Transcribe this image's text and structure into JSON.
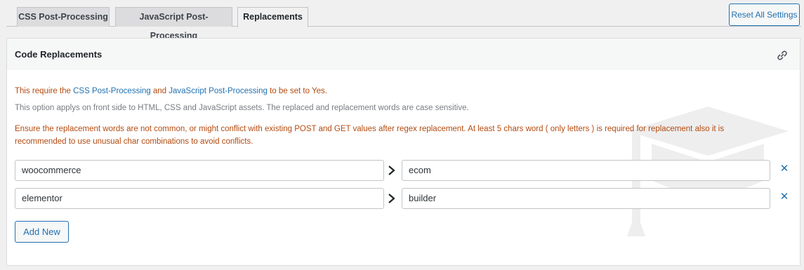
{
  "tabs": [
    {
      "label": "CSS Post-Processing",
      "active": false
    },
    {
      "label": "JavaScript Post-Processing",
      "active": false
    },
    {
      "label": "Replacements",
      "active": true
    }
  ],
  "reset_button": "Reset All Settings",
  "panel": {
    "title": "Code Replacements",
    "notice": {
      "prefix": "This require the ",
      "link1": "CSS Post-Processing",
      "middle": " and ",
      "link2": "JavaScript Post-Processing",
      "suffix": " to be set to Yes."
    },
    "description": "This option applys on front side to HTML, CSS and JavaScript assets. The replaced and replacement words are case sensitive.",
    "warning": "Ensure the replacement words are not common, or might conflict with existing POST and GET values after regex replacement. At least 5 chars word ( only letters ) is required for replacement also it is recommended to use unusual char combinations to avoid conflicts.",
    "replacements": [
      {
        "from": "woocommerce",
        "to": "ecom"
      },
      {
        "from": "elementor",
        "to": "builder"
      }
    ],
    "add_button": "Add New"
  },
  "icons": {
    "header_link": "link-icon",
    "separator": "chevron-right-icon",
    "remove": "close-icon",
    "watermark": "graduation-cap-icon"
  },
  "colors": {
    "accent": "#2271b1",
    "warning": "#b34a0f",
    "muted": "#787c82"
  }
}
